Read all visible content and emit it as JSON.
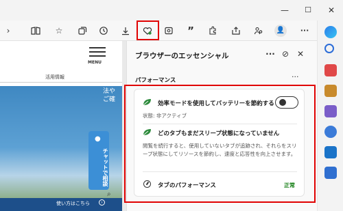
{
  "window": {
    "minimize": "—",
    "maximize": "☐",
    "close": "✕"
  },
  "toolbar": {
    "icons": [
      "reader-view-icon",
      "favorites-icon",
      "collections-icon",
      "history-icon",
      "downloads-icon",
      "essentials-icon",
      "screenshot-icon",
      "quote-icon",
      "extensions-icon",
      "share-icon",
      "family-icon",
      "profile-icon",
      "more-icon"
    ],
    "more": "···",
    "profile": "👤"
  },
  "page": {
    "menu_label": "MENU",
    "usage_tab": "活用情報",
    "hero_text": "法や\nご確",
    "chat_button": "チャットで相談",
    "howto": "使い方はこちら",
    "howto_icon": "›"
  },
  "panel": {
    "title": "ブラウザーのエッセンシャル",
    "more": "···",
    "pin": "⊘",
    "close": "✕",
    "performance_heading": "パフォーマンス",
    "performance_more": "···",
    "efficiency": {
      "title": "効率モードを使用してバッテリーを節約する",
      "status": "状態: 非アクティブ",
      "toggle_on": false
    },
    "sleeping": {
      "title": "どのタブもまだスリープ状態になっていません",
      "description": "閲覧を続行すると、使用していないタブが追跡され、それらをスリープ状態にしてリソースを節約し、速度と応答性を向上させます。"
    },
    "tab_performance": {
      "label": "タブのパフォーマンス",
      "status": "正常"
    }
  },
  "colors": {
    "highlight": "#e00000",
    "status_good": "#107c10",
    "leaf_green": "#2e8b3d",
    "chat_blue": "#3c8fd6"
  }
}
